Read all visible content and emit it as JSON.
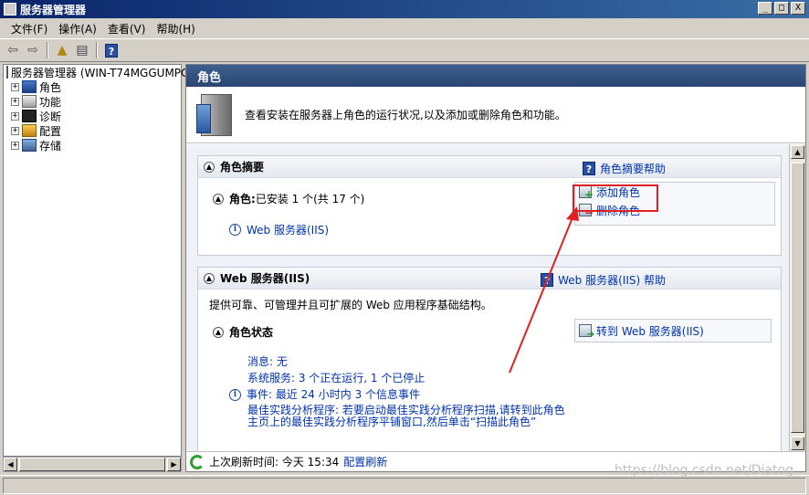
{
  "window": {
    "title": "服务器管理器",
    "controls": [
      "_",
      "□",
      "X"
    ]
  },
  "menu": [
    "文件(F)",
    "操作(A)",
    "查看(V)",
    "帮助(H)"
  ],
  "toolbar": {
    "help": "?"
  },
  "tree": {
    "root": "服务器管理器 (WIN-T74MGGUMPG",
    "items": [
      "角色",
      "功能",
      "诊断",
      "配置",
      "存储"
    ]
  },
  "pane": {
    "header": "角色",
    "intro": "查看安装在服务器上角色的运行状况,以及添加或删除角色和功能。",
    "summary": {
      "title": "角色摘要",
      "help": "角色摘要帮助",
      "roles_label": "角色:",
      "roles_count": "已安装 1 个(共 17 个)",
      "installed_role": "Web 服务器(IIS)",
      "add_role": "添加角色",
      "remove_role": "删除角色"
    },
    "web": {
      "title": "Web 服务器(IIS)",
      "help": "Web 服务器(IIS) 帮助",
      "description": "提供可靠、可管理并且可扩展的 Web 应用程序基础结构。",
      "status_title": "角色状态",
      "goto": "转到 Web 服务器(IIS)",
      "messages": "消息: 无",
      "services": "系统服务: 3 个正在运行, 1 个已停止",
      "events": "事件: 最近 24 小时内 3 个信息事件",
      "bpa": "最佳实践分析程序: 若要启动最佳实践分析程序扫描,请转到此角色主页上的最佳实践分析程序平铺窗口,然后单击“扫描此角色”"
    },
    "footer": {
      "last_refresh": "上次刷新时间: 今天 15:34",
      "configure_refresh": "配置刷新"
    }
  },
  "watermark": "https://blog.csdn.net/Diatog_",
  "colors": {
    "pane_header": "#2b4672",
    "link": "#0033aa",
    "highlight": "#e02020"
  }
}
